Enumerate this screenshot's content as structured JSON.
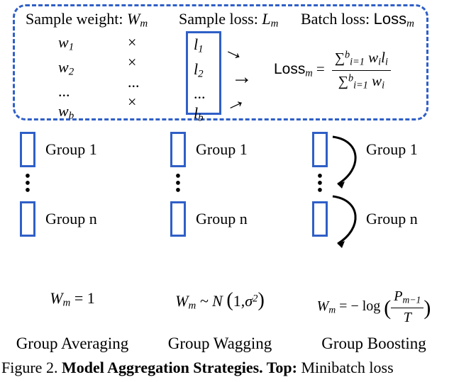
{
  "top": {
    "header_weight": "Sample weight:",
    "header_weight_symbol": "W",
    "header_weight_sub": "m",
    "header_loss": "Sample loss:",
    "header_loss_symbol": "L",
    "header_loss_sub": "m",
    "header_batch": "Batch loss:",
    "header_batch_symbol": "Loss",
    "header_batch_sub": "m",
    "weights": [
      "w",
      "w",
      "...",
      "w"
    ],
    "weights_sub": [
      "1",
      "2",
      "",
      "b"
    ],
    "times": [
      "×",
      "×",
      "...",
      "×"
    ],
    "losses": [
      "l",
      "l",
      "...",
      "l"
    ],
    "losses_sub": [
      "1",
      "2",
      "",
      "b"
    ],
    "eq_lhs": "Loss",
    "eq_lhs_sub": "m",
    "eq_eq": "=",
    "eq_num": "∑",
    "eq_num_sub": "i=1",
    "eq_num_sup": "b",
    "eq_num_body1": "w",
    "eq_num_body1_sub": "i",
    "eq_num_body2": "l",
    "eq_num_body2_sub": "i",
    "eq_den": "∑",
    "eq_den_sub": "i=1",
    "eq_den_sup": "b",
    "eq_den_body1": "w",
    "eq_den_body1_sub": "i"
  },
  "groups": {
    "label1": "Group 1",
    "labeln": "Group n"
  },
  "strategies": {
    "avg": {
      "eq_lhs": "W",
      "eq_lhs_sub": "m",
      "eq_rhs": "= 1",
      "name": "Group Averaging"
    },
    "wag": {
      "eq_lhs": "W",
      "eq_lhs_sub": "m",
      "eq_mid": "~ N",
      "eq_arg1": "1,",
      "eq_arg2": "σ",
      "eq_arg2_sup": "2",
      "name": "Group Wagging"
    },
    "boost": {
      "eq_lhs": "W",
      "eq_lhs_sub": "m",
      "eq_pre": "= − log",
      "eq_num": "P",
      "eq_num_sub": "m−1",
      "eq_den": "T",
      "name": "Group Boosting"
    }
  },
  "caption": {
    "prefix": "Figure 2. ",
    "bold": "Model Aggregation Strategies.  Top:",
    "rest": " Minibatch loss"
  }
}
